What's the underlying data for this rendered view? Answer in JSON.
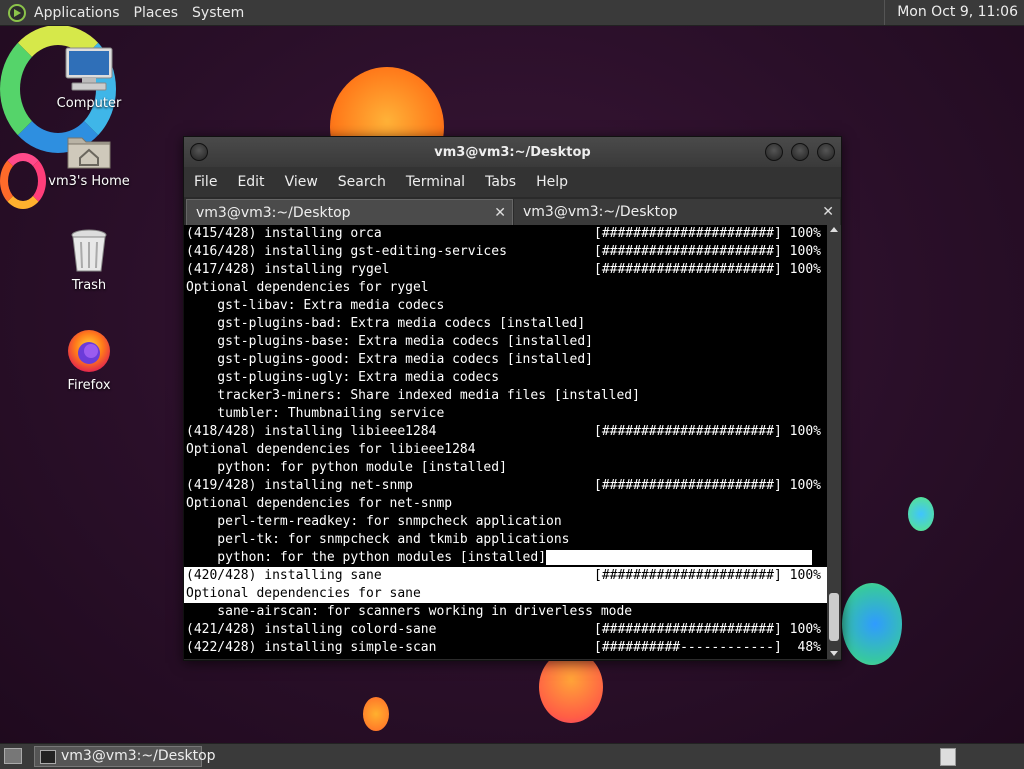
{
  "top_panel": {
    "menus": [
      "Applications",
      "Places",
      "System"
    ],
    "clock": "Mon Oct  9, 11:06"
  },
  "desktop_icons": [
    {
      "label": "Computer",
      "icon": "computer-icon"
    },
    {
      "label": "vm3's Home",
      "icon": "home-folder-icon"
    },
    {
      "label": "Trash",
      "icon": "trash-icon"
    },
    {
      "label": "Firefox",
      "icon": "firefox-icon"
    }
  ],
  "terminal": {
    "title": "vm3@vm3:~/Desktop",
    "menu": [
      "File",
      "Edit",
      "View",
      "Search",
      "Terminal",
      "Tabs",
      "Help"
    ],
    "tabs": [
      {
        "label": "vm3@vm3:~/Desktop",
        "active": true
      },
      {
        "label": "vm3@vm3:~/Desktop",
        "active": false
      }
    ],
    "lines": [
      {
        "text": "(415/428) installing orca",
        "bar": "[######################] 100%"
      },
      {
        "text": "(416/428) installing gst-editing-services",
        "bar": "[######################] 100%"
      },
      {
        "text": "(417/428) installing rygel",
        "bar": "[######################] 100%"
      },
      {
        "text": "Optional dependencies for rygel",
        "bar": ""
      },
      {
        "text": "    gst-libav: Extra media codecs",
        "bar": ""
      },
      {
        "text": "    gst-plugins-bad: Extra media codecs [installed]",
        "bar": ""
      },
      {
        "text": "    gst-plugins-base: Extra media codecs [installed]",
        "bar": ""
      },
      {
        "text": "    gst-plugins-good: Extra media codecs [installed]",
        "bar": ""
      },
      {
        "text": "    gst-plugins-ugly: Extra media codecs",
        "bar": ""
      },
      {
        "text": "    tracker3-miners: Share indexed media files [installed]",
        "bar": ""
      },
      {
        "text": "    tumbler: Thumbnailing service",
        "bar": ""
      },
      {
        "text": "(418/428) installing libieee1284",
        "bar": "[######################] 100%"
      },
      {
        "text": "Optional dependencies for libieee1284",
        "bar": ""
      },
      {
        "text": "    python: for python module [installed]",
        "bar": ""
      },
      {
        "text": "(419/428) installing net-snmp",
        "bar": "[######################] 100%"
      },
      {
        "text": "Optional dependencies for net-snmp",
        "bar": ""
      },
      {
        "text": "    perl-term-readkey: for snmpcheck application",
        "bar": ""
      },
      {
        "text": "    perl-tk: for snmpcheck and tkmib applications",
        "bar": ""
      },
      {
        "text": "    python: for the python modules [installed]",
        "bar": ""
      },
      {
        "text": "(420/428) installing sane",
        "bar": "[######################] 100%"
      },
      {
        "text": "Optional dependencies for sane",
        "bar": ""
      },
      {
        "text": "    sane-airscan: for scanners working in driverless mode",
        "bar": ""
      },
      {
        "text": "(421/428) installing colord-sane",
        "bar": "[######################] 100%"
      },
      {
        "text": "(422/428) installing simple-scan",
        "bar": "[##########------------]  48%"
      }
    ]
  },
  "taskbar": {
    "task_label": "vm3@vm3:~/Desktop"
  }
}
